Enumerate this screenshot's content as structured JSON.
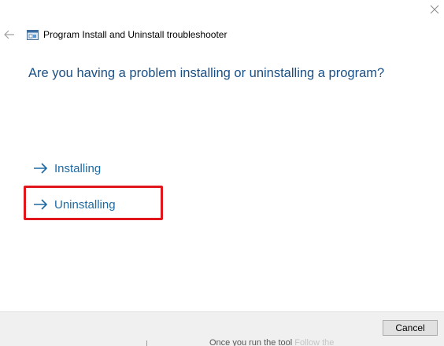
{
  "window": {
    "title": "Program Install and Uninstall troubleshooter",
    "close_icon": "close-icon",
    "back_icon": "back-arrow-icon",
    "app_icon": "troubleshooter-app-icon"
  },
  "main": {
    "question": "Are you having a problem installing or uninstalling a program?",
    "options": [
      {
        "label": "Installing",
        "icon": "arrow-right-icon"
      },
      {
        "label": "Uninstalling",
        "icon": "arrow-right-icon",
        "highlighted": true
      }
    ]
  },
  "footer": {
    "cancel_label": "Cancel",
    "background_text": "Once you run the tool",
    "background_text_faint": "Follow the"
  },
  "colors": {
    "question": "#1a4f86",
    "option_link": "#1b6aa5",
    "highlight": "#e1161c",
    "footer_bg": "#f0f0f0"
  }
}
